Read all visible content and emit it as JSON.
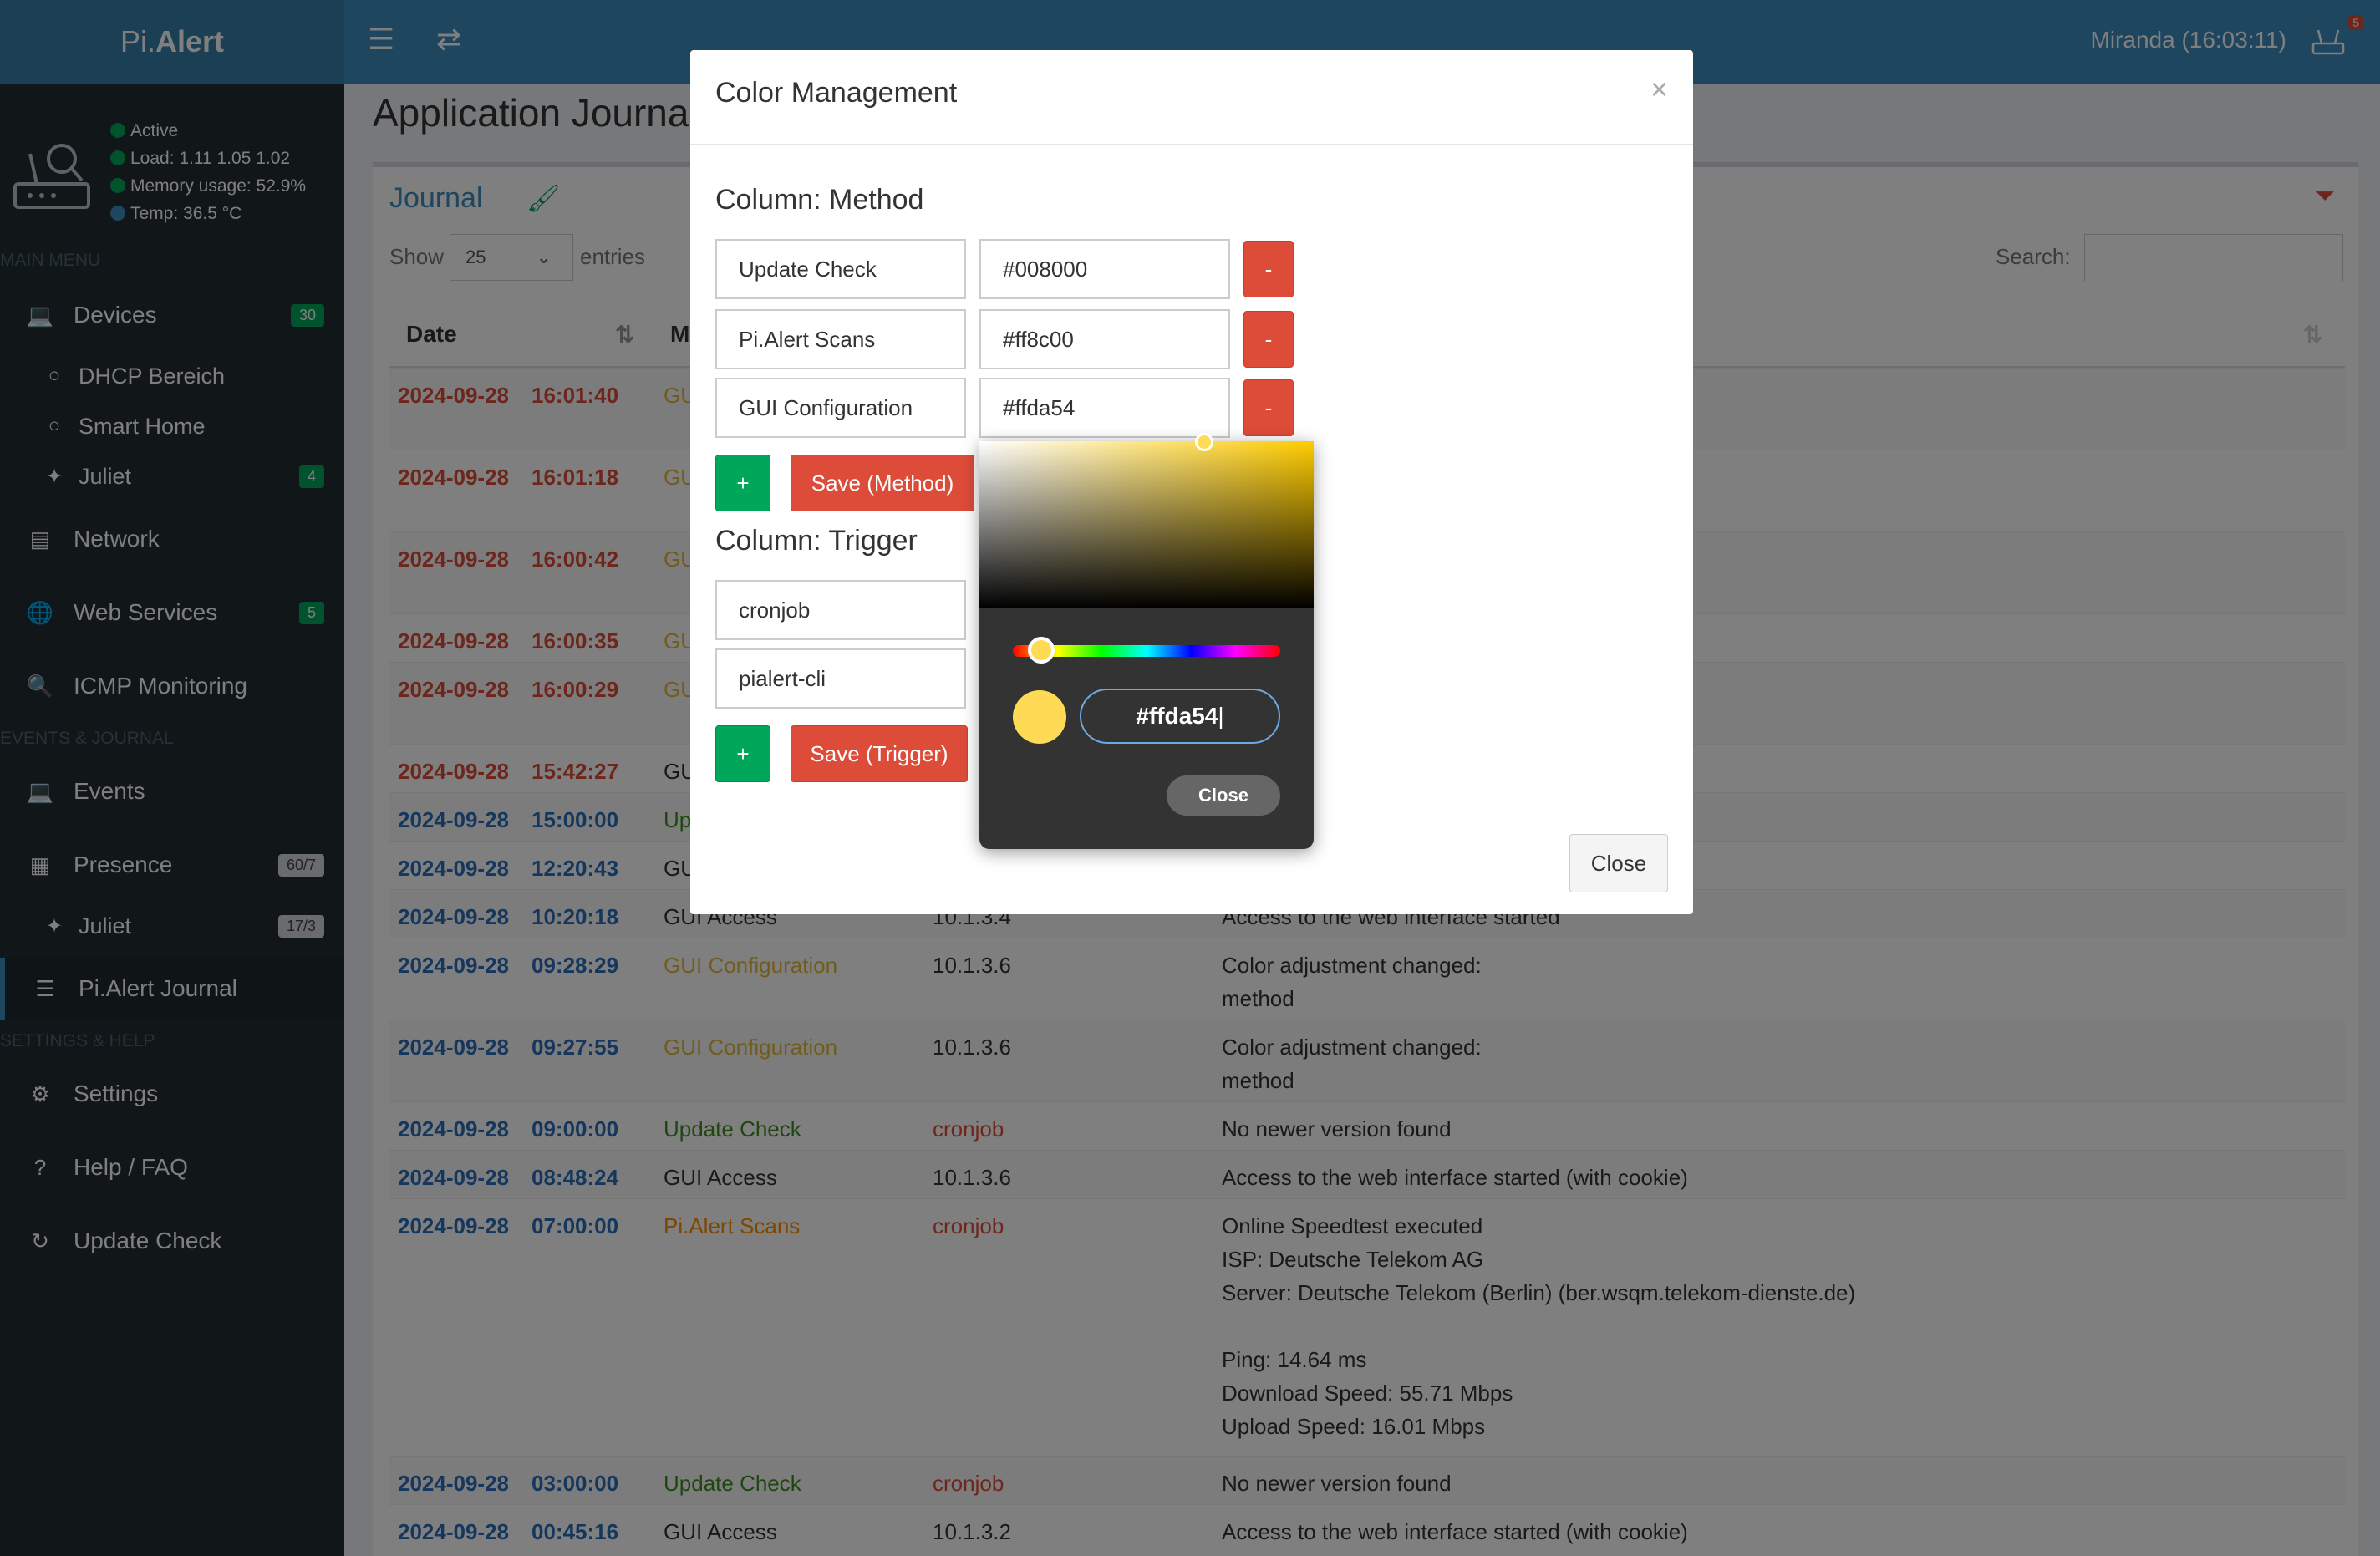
{
  "header": {
    "logo_pre": "Pi.",
    "logo_bold": "Alert",
    "user": "Miranda (16:03:11)",
    "notif_count": "5"
  },
  "sidebar": {
    "status": {
      "active": "Active",
      "load": "Load:  1.11  1.05  1.02",
      "memory": "Memory usage:  52.9%",
      "temp": "Temp: 36.5 °C"
    },
    "main_menu": "MAIN MENU",
    "devices": "Devices",
    "devices_badge": "30",
    "dhcp": "DHCP Bereich",
    "smart_home": "Smart Home",
    "juliet": "Juliet",
    "juliet_badge": "4",
    "network": "Network",
    "web_services": "Web Services",
    "web_services_badge": "5",
    "icmp": "ICMP Monitoring",
    "events_section": "EVENTS & JOURNAL",
    "events": "Events",
    "presence": "Presence",
    "presence_badge": "60/7",
    "juliet2": "Juliet",
    "juliet2_badge": "17/3",
    "journal": "Pi.Alert Journal",
    "settings_section": "SETTINGS & HELP",
    "settings": "Settings",
    "help": "Help / FAQ",
    "update_check": "Update Check"
  },
  "main": {
    "page_title": "Application Journal",
    "box_title": "Journal",
    "show_label": "Show",
    "show_value": "25",
    "entries_label": "entries",
    "search_label": "Search:",
    "col_date": "Date",
    "col_method": "Me"
  },
  "rows": [
    {
      "date": "2024-09-28",
      "time": "16:01:40",
      "method": "GUI",
      "trigger": "",
      "text": "",
      "dcolor": "red",
      "mcolor": "gold"
    },
    {
      "date": "2024-09-28",
      "time": "16:01:18",
      "method": "GUI",
      "trigger": "",
      "text": "",
      "dcolor": "red",
      "mcolor": "gold"
    },
    {
      "date": "2024-09-28",
      "time": "16:00:42",
      "method": "GUI",
      "trigger": "",
      "text": "",
      "dcolor": "red",
      "mcolor": "gold"
    },
    {
      "date": "2024-09-28",
      "time": "16:00:35",
      "method": "GUI",
      "trigger": "",
      "text": "",
      "dcolor": "red",
      "mcolor": "gold"
    },
    {
      "date": "2024-09-28",
      "time": "16:00:29",
      "method": "GUI",
      "trigger": "",
      "text": "",
      "dcolor": "red",
      "mcolor": "gold"
    },
    {
      "date": "2024-09-28",
      "time": "15:42:27",
      "method": "GUI",
      "trigger": "",
      "text": "",
      "dcolor": "red",
      "mcolor": ""
    },
    {
      "date": "2024-09-28",
      "time": "15:00:00",
      "method": "Up",
      "trigger": "",
      "text": "",
      "dcolor": "blue",
      "mcolor": "green"
    },
    {
      "date": "2024-09-28",
      "time": "12:20:43",
      "method": "GUI",
      "trigger": "",
      "text": "",
      "dcolor": "blue",
      "mcolor": ""
    },
    {
      "date": "2024-09-28",
      "time": "10:20:18",
      "method": "GUI Access",
      "trigger": "10.1.3.4",
      "text": "Access to the web interface started",
      "dcolor": "blue",
      "mcolor": ""
    },
    {
      "date": "2024-09-28",
      "time": "09:28:29",
      "method": "GUI Configuration",
      "trigger": "10.1.3.6",
      "text": "Color adjustment changed:\nmethod",
      "dcolor": "blue",
      "mcolor": "gold"
    },
    {
      "date": "2024-09-28",
      "time": "09:27:55",
      "method": "GUI Configuration",
      "trigger": "10.1.3.6",
      "text": "Color adjustment changed:\nmethod",
      "dcolor": "blue",
      "mcolor": "gold"
    },
    {
      "date": "2024-09-28",
      "time": "09:00:00",
      "method": "Update Check",
      "trigger": "cronjob",
      "text": "No newer version found",
      "dcolor": "blue",
      "mcolor": "green",
      "tcolor": "red"
    },
    {
      "date": "2024-09-28",
      "time": "08:48:24",
      "method": "GUI Access",
      "trigger": "10.1.3.6",
      "text": "Access to the web interface started (with cookie)",
      "dcolor": "blue",
      "mcolor": ""
    },
    {
      "date": "2024-09-28",
      "time": "07:00:00",
      "method": "Pi.Alert Scans",
      "trigger": "cronjob",
      "text": "Online Speedtest executed\nISP: Deutsche Telekom AG\nServer: Deutsche Telekom (Berlin) (ber.wsqm.telekom-dienste.de)\n\nPing: 14.64 ms\nDownload Speed: 55.71 Mbps\nUpload Speed: 16.01 Mbps",
      "dcolor": "blue",
      "mcolor": "orange",
      "tcolor": "red"
    },
    {
      "date": "2024-09-28",
      "time": "03:00:00",
      "method": "Update Check",
      "trigger": "cronjob",
      "text": "No newer version found",
      "dcolor": "blue",
      "mcolor": "green",
      "tcolor": "red"
    },
    {
      "date": "2024-09-28",
      "time": "00:45:16",
      "method": "GUI Access",
      "trigger": "10.1.3.2",
      "text": "Access to the web interface started (with cookie)",
      "dcolor": "blue",
      "mcolor": ""
    }
  ],
  "modal": {
    "title": "Color Management",
    "close_x": "×",
    "method_title": "Column: Method",
    "method_rows": [
      {
        "name": "Update Check",
        "color": "#008000"
      },
      {
        "name": "Pi.Alert Scans",
        "color": "#ff8c00"
      },
      {
        "name": "GUI Configuration",
        "color": "#ffda54"
      }
    ],
    "minus": "-",
    "plus": "+",
    "save_method": "Save (Method)",
    "trigger_title": "Column: Trigger",
    "trigger_rows": [
      "cronjob",
      "pialert-cli"
    ],
    "save_trigger": "Save (Trigger)",
    "close": "Close"
  },
  "picker": {
    "hex": "#ffda54",
    "close": "Close",
    "color": "#ffda54"
  }
}
